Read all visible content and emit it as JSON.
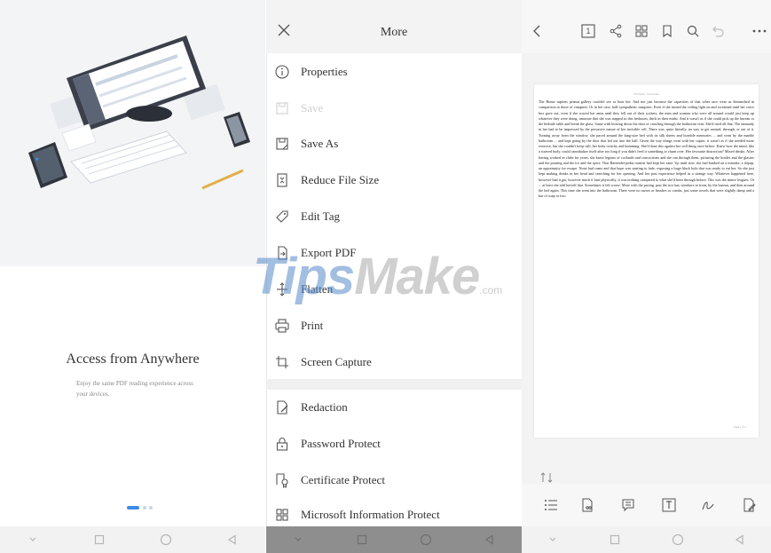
{
  "onboarding": {
    "title": "Access from Anywhere",
    "subtitle": "Enjoy the same PDF reading experience across your devices.",
    "page_indicator": {
      "current": 1,
      "total": 3
    }
  },
  "more_menu": {
    "title": "More",
    "items": [
      {
        "label": "Properties",
        "icon": "info-icon",
        "enabled": true
      },
      {
        "label": "Save",
        "icon": "save-icon",
        "enabled": false
      },
      {
        "label": "Save As",
        "icon": "save-as-icon",
        "enabled": true
      },
      {
        "label": "Reduce File Size",
        "icon": "reduce-file-size-icon",
        "enabled": true
      },
      {
        "label": "Edit Tag",
        "icon": "tag-icon",
        "enabled": true
      },
      {
        "label": "Export PDF",
        "icon": "export-pdf-icon",
        "enabled": true
      },
      {
        "label": "Flatten",
        "icon": "flatten-icon",
        "enabled": true
      },
      {
        "label": "Print",
        "icon": "printer-icon",
        "enabled": true
      },
      {
        "label": "Screen Capture",
        "icon": "screen-capture-icon",
        "enabled": true
      },
      {
        "label": "Redaction",
        "icon": "redaction-icon",
        "enabled": true
      },
      {
        "label": "Password Protect",
        "icon": "lock-icon",
        "enabled": true
      },
      {
        "label": "Certificate Protect",
        "icon": "certificate-icon",
        "enabled": true
      },
      {
        "label": "Microsoft Information Protect",
        "icon": "grid-icon",
        "enabled": true
      }
    ]
  },
  "reader": {
    "page_number_badge": "1",
    "document": {
      "header": "UN World · Great Tales",
      "body": "The Hume sapiens peanut gallery couldn't see or hear her. And not just because the capacities of that other race were as diminished in comparison to those of vampires. Or in her case, half-sympathetic vampires. Even if she turned the ceiling light on and screamed until her voice box gave out, even if she waved her arms until they fell out of their sockets, the men and women who were all around would just keep up whatever they were doing, unaware that she was trapped in this bedroom, thick in their midst. And it wasn't as if she could pick up the bureau or the bedside table and break the glass. Same with kicking down the door or crawling through the bathroom vent. She'd tried all that. The unmanly in her had to be impressed by the pervasive nature of her invisible cell. There was, quite literally, no way to get around, through, or out of it. Turning away from the window, she paced around the king-size bed with its silk sheets and horrible memories ... and went by the marble bathroom ... and kept going by the door that led out into the hall. Given the way things went with her captor, it wasn't as if she needed more exercise, but she couldn't keep still, her body twitchy and humming. She'd done this against her will thing once before. Knew how the mind, like a starved body, could cannibalize itself after too long if you didn't feed it something to churn over. Her favourite distraction? Mixed drinks. After having worked in clubs for years, she knew legions of cocktails and concoctions and she ran through them, picturing the bottles and the glasses and the pouring and the ice and the spice. That Bartender-pedia routine had kept her sane. Up until now, she had banked on a mistake, a slipup, an opportunity for escape. None had come and that hope was starting to fade, exposing a huge black hole that was ready to eat her. So she just kept making drinks in her head and searching for her opening. And her past experience helped in a strange way. Whatever happened here, however bad it got, however much it hurt physically, it was nothing compared to what she'd been through before. This was the minor leagues. Or ... at least she told herself that. Sometimes it felt worse. More with the pacing, past the two bay windows in front, by the bureau, and then around the bed again. This time she went into the bathroom. There were no razors or brushes or combs, just some towels that were slightly damp and a bar of soap or two.",
      "page_label": "Page 1 of 1"
    }
  },
  "watermark": {
    "brand": "Tips",
    "brand2": "Make",
    "suffix": ".com"
  },
  "colors": {
    "accent": "#3c8be8",
    "menu_header_bg": "#f3f3f3",
    "dark_navbar": "#8e8e8e",
    "disabled_text": "#cfcfcf"
  }
}
